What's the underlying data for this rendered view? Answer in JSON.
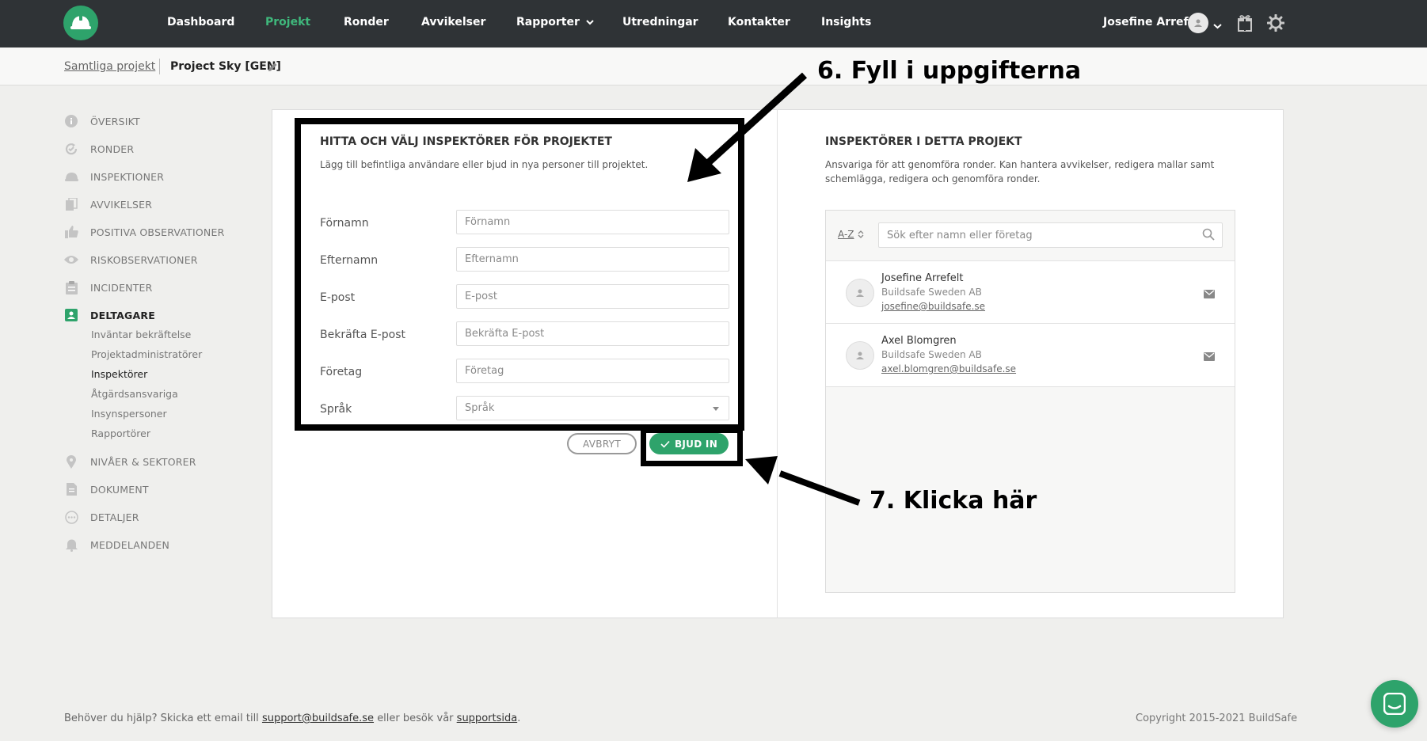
{
  "nav": {
    "items": [
      {
        "id": "dashboard",
        "label": "Dashboard"
      },
      {
        "id": "projekt",
        "label": "Projekt"
      },
      {
        "id": "ronder",
        "label": "Ronder"
      },
      {
        "id": "avvikelser",
        "label": "Avvikelser"
      },
      {
        "id": "rapporter",
        "label": "Rapporter"
      },
      {
        "id": "utredningar",
        "label": "Utredningar"
      },
      {
        "id": "kontakter",
        "label": "Kontakter"
      },
      {
        "id": "insights",
        "label": "Insights"
      }
    ],
    "active": "Projekt",
    "user_name": "Josefine Arrefelt"
  },
  "breadcrumb": {
    "parent": "Samtliga projekt",
    "current": "Project Sky [GEN]"
  },
  "sidebar": {
    "items": [
      {
        "label": "ÖVERSIKT",
        "icon": "info-icon"
      },
      {
        "label": "RONDER",
        "icon": "refresh-check-icon"
      },
      {
        "label": "INSPEKTIONER",
        "icon": "helmet-icon"
      },
      {
        "label": "AVVIKELSER",
        "icon": "document-copy-icon"
      },
      {
        "label": "POSITIVA OBSERVATIONER",
        "icon": "thumbs-up-icon"
      },
      {
        "label": "RISKOBSERVATIONER",
        "icon": "eye-icon"
      },
      {
        "label": "INCIDENTER",
        "icon": "clipboard-icon"
      },
      {
        "label": "DELTAGARE",
        "icon": "contact-card-icon"
      },
      {
        "label": "NIVÅER & SEKTORER",
        "icon": "location-pin-icon"
      },
      {
        "label": "DOKUMENT",
        "icon": "document-icon"
      },
      {
        "label": "DETALJER",
        "icon": "more-circle-icon"
      },
      {
        "label": "MEDDELANDEN",
        "icon": "bell-icon"
      }
    ],
    "sub_items": [
      "Inväntar bekräftelse",
      "Projektadministratörer",
      "Inspektörer",
      "Åtgärdsansvariga",
      "Insynspersoner",
      "Rapportörer"
    ],
    "active_item": "DELTAGARE",
    "active_sub": "Inspektörer"
  },
  "invite_form": {
    "title": "HITTA OCH VÄLJ INSPEKTÖRER FÖR PROJEKTET",
    "description": "Lägg till befintliga användare eller bjud in nya personer till projektet.",
    "fields": {
      "first_name": {
        "label": "Förnamn",
        "placeholder": "Förnamn",
        "value": ""
      },
      "last_name": {
        "label": "Efternamn",
        "placeholder": "Efternamn",
        "value": ""
      },
      "email": {
        "label": "E-post",
        "placeholder": "E-post",
        "value": ""
      },
      "confirm_email": {
        "label": "Bekräfta E-post",
        "placeholder": "Bekräfta E-post",
        "value": ""
      },
      "company": {
        "label": "Företag",
        "placeholder": "Företag",
        "value": ""
      },
      "language": {
        "label": "Språk",
        "placeholder": "Språk"
      }
    },
    "cancel_label": "AVBRYT",
    "invite_label": "BJUD IN"
  },
  "inspectors": {
    "title": "INSPEKTÖRER I DETTA PROJEKT",
    "description": "Ansvariga för att genomföra ronder. Kan hantera avvikelser, redigera mallar samt schemlägga, redigera och genomföra ronder.",
    "sort_label": "A-Z",
    "search_placeholder": "Sök efter namn eller företag",
    "people": [
      {
        "name": "Josefine Arrefelt",
        "company": "Buildsafe Sweden AB",
        "email": "josefine@buildsafe.se"
      },
      {
        "name": "Axel Blomgren",
        "company": "Buildsafe Sweden AB",
        "email": "axel.blomgren@buildsafe.se"
      }
    ]
  },
  "annotations": {
    "step6": "6. Fyll i uppgifterna",
    "step7": "7. Klicka här"
  },
  "footer": {
    "help_prefix": "Behöver du hjälp? Skicka ett email till",
    "support_email": "support@buildsafe.se",
    "help_middle": "eller besök vår",
    "support_link": "supportsida",
    "help_suffix": ".",
    "copyright": "Copyright 2015-2021 BuildSafe"
  },
  "colors": {
    "topbar": "#2f3336",
    "brand_green": "#2ea36b",
    "active_nav": "#3fb87c"
  }
}
